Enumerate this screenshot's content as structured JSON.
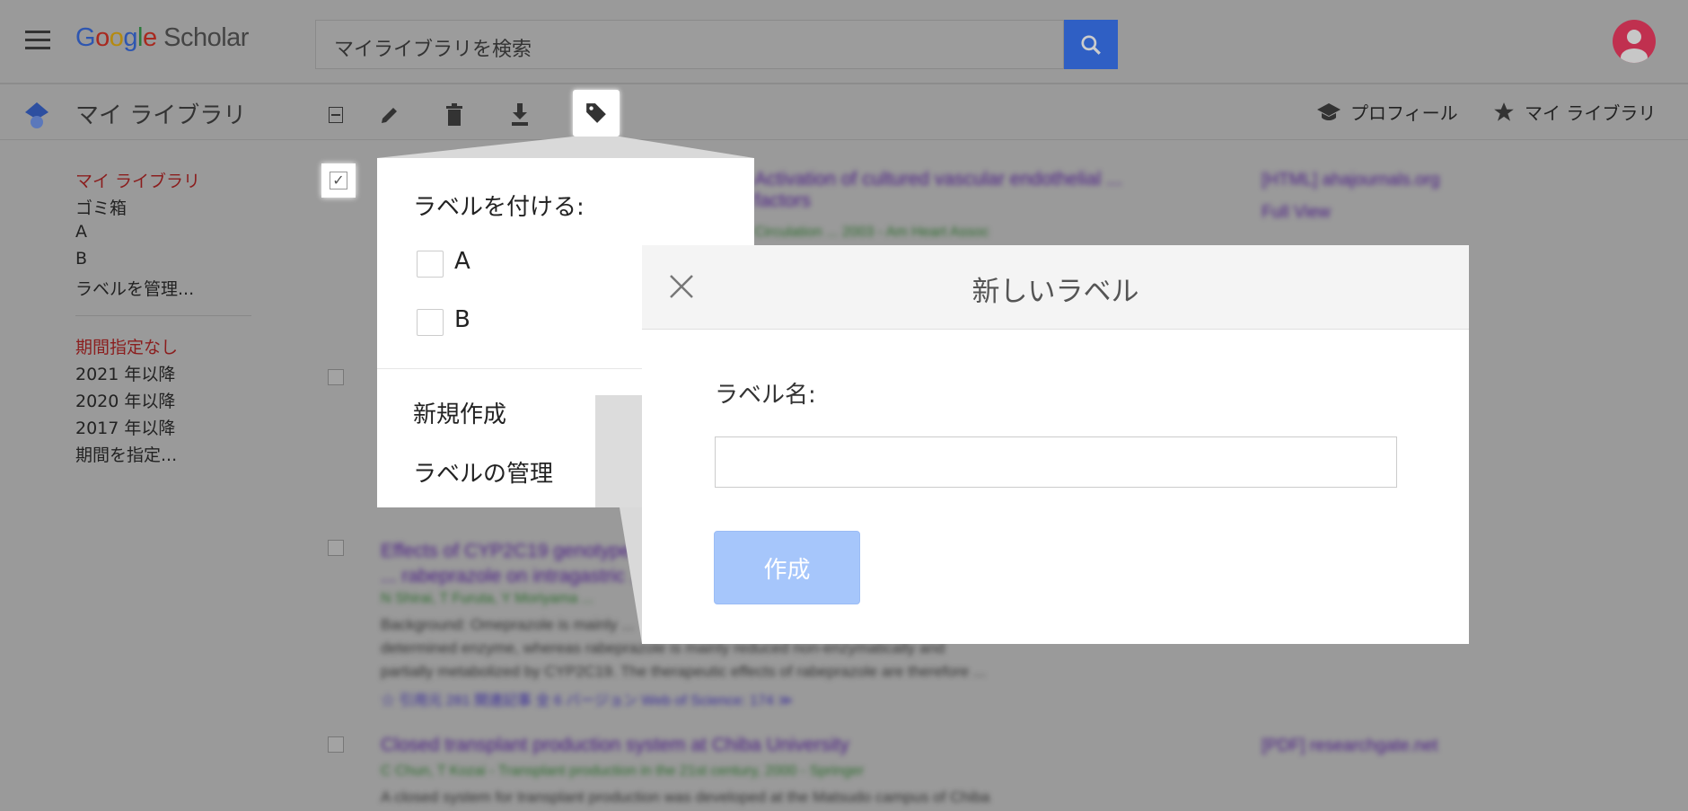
{
  "header": {
    "logo": {
      "google": "Google",
      "scholar": "Scholar"
    },
    "search_placeholder": "マイライブラリを検索"
  },
  "toolbar": {
    "title": "マイ ライブラリ",
    "profile": "プロフィール",
    "my_library": "マイ ライブラリ"
  },
  "sidebar": {
    "collections": [
      "マイ ライブラリ",
      "ゴミ箱",
      "A",
      "B",
      "ラベルを管理..."
    ],
    "dates": [
      "期間指定なし",
      "2021 年以降",
      "2020 年以降",
      "2017 年以降",
      "期間を指定..."
    ]
  },
  "results": [
    {
      "title": "Activation of cultured vascular endothelial ... factors",
      "meta": "Circulation ... 2003 - Am Heart Assoc",
      "source": "[HTML] ahajournals.org",
      "source2": "Full View"
    },
    {
      "title": "Effects of CYP2C19 genotype ... rabeprazole on intragastric ...",
      "meta": "N Shirai, T Furuta, Y Moriyama ...",
      "snippet": [
        "Background: Omeprazole is mainly ...",
        "determined enzyme, whereas rabeprazole is mainly reduced non-enzymatically and",
        "partially metabolized by CYP2C19. The therapeutic effects of rabeprazole are therefore ..."
      ],
      "links": "☆ 引用元 281 関連記事 全 6 バージョン Web of Science: 174 ≫"
    },
    {
      "title": "Closed transplant production system at Chiba University",
      "meta": "C Chun, T Kozai - Transplant production in the 21st century, 2000 - Springer",
      "snippet": [
        "A closed system for transplant production was developed at the Matsudo campus of Chiba"
      ],
      "source": "[PDF] researchgate.net"
    }
  ],
  "label_menu": {
    "heading": "ラベルを付ける:",
    "labels": [
      {
        "name": "A",
        "checked": false
      },
      {
        "name": "B",
        "checked": false
      }
    ],
    "create": "新規作成",
    "manage": "ラベルの管理"
  },
  "dialog": {
    "title": "新しいラベル",
    "field_label": "ラベル名:",
    "field_value": "",
    "create_button": "作成"
  },
  "colors": {
    "accent": "#4285f4",
    "button_disabled": "#a6c6fb",
    "sidebar_active": "#8b1d1d",
    "avatar": "#c0304f"
  }
}
